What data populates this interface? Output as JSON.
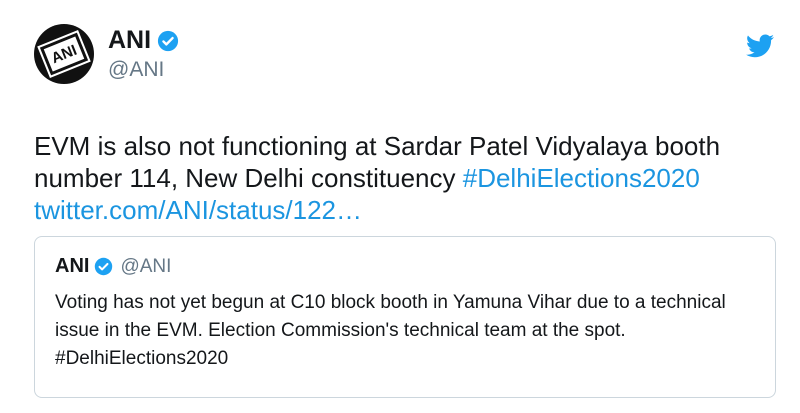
{
  "tweet": {
    "name": "ANI",
    "handle": "@ANI",
    "avatar_text": "ANI",
    "text_before": "EVM is also not functioning at Sardar Patel Vidyalaya booth number 114, New Delhi constituency ",
    "hashtag": "#DelhiElections2020",
    "link": "twitter.com/ANI/status/122…"
  },
  "quoted": {
    "name": "ANI",
    "handle": "@ANI",
    "text": "Voting has not yet begun at C10 block booth in Yamuna Vihar due to a technical issue in the EVM.  Election Commission's technical team at the spot. #DelhiElections2020"
  },
  "colors": {
    "link": "#1b95e0",
    "verified": "#1da1f2",
    "handle": "#657786",
    "border": "#ccd6dd"
  },
  "icons": [
    "verified-badge-icon",
    "twitter-bird-icon"
  ]
}
